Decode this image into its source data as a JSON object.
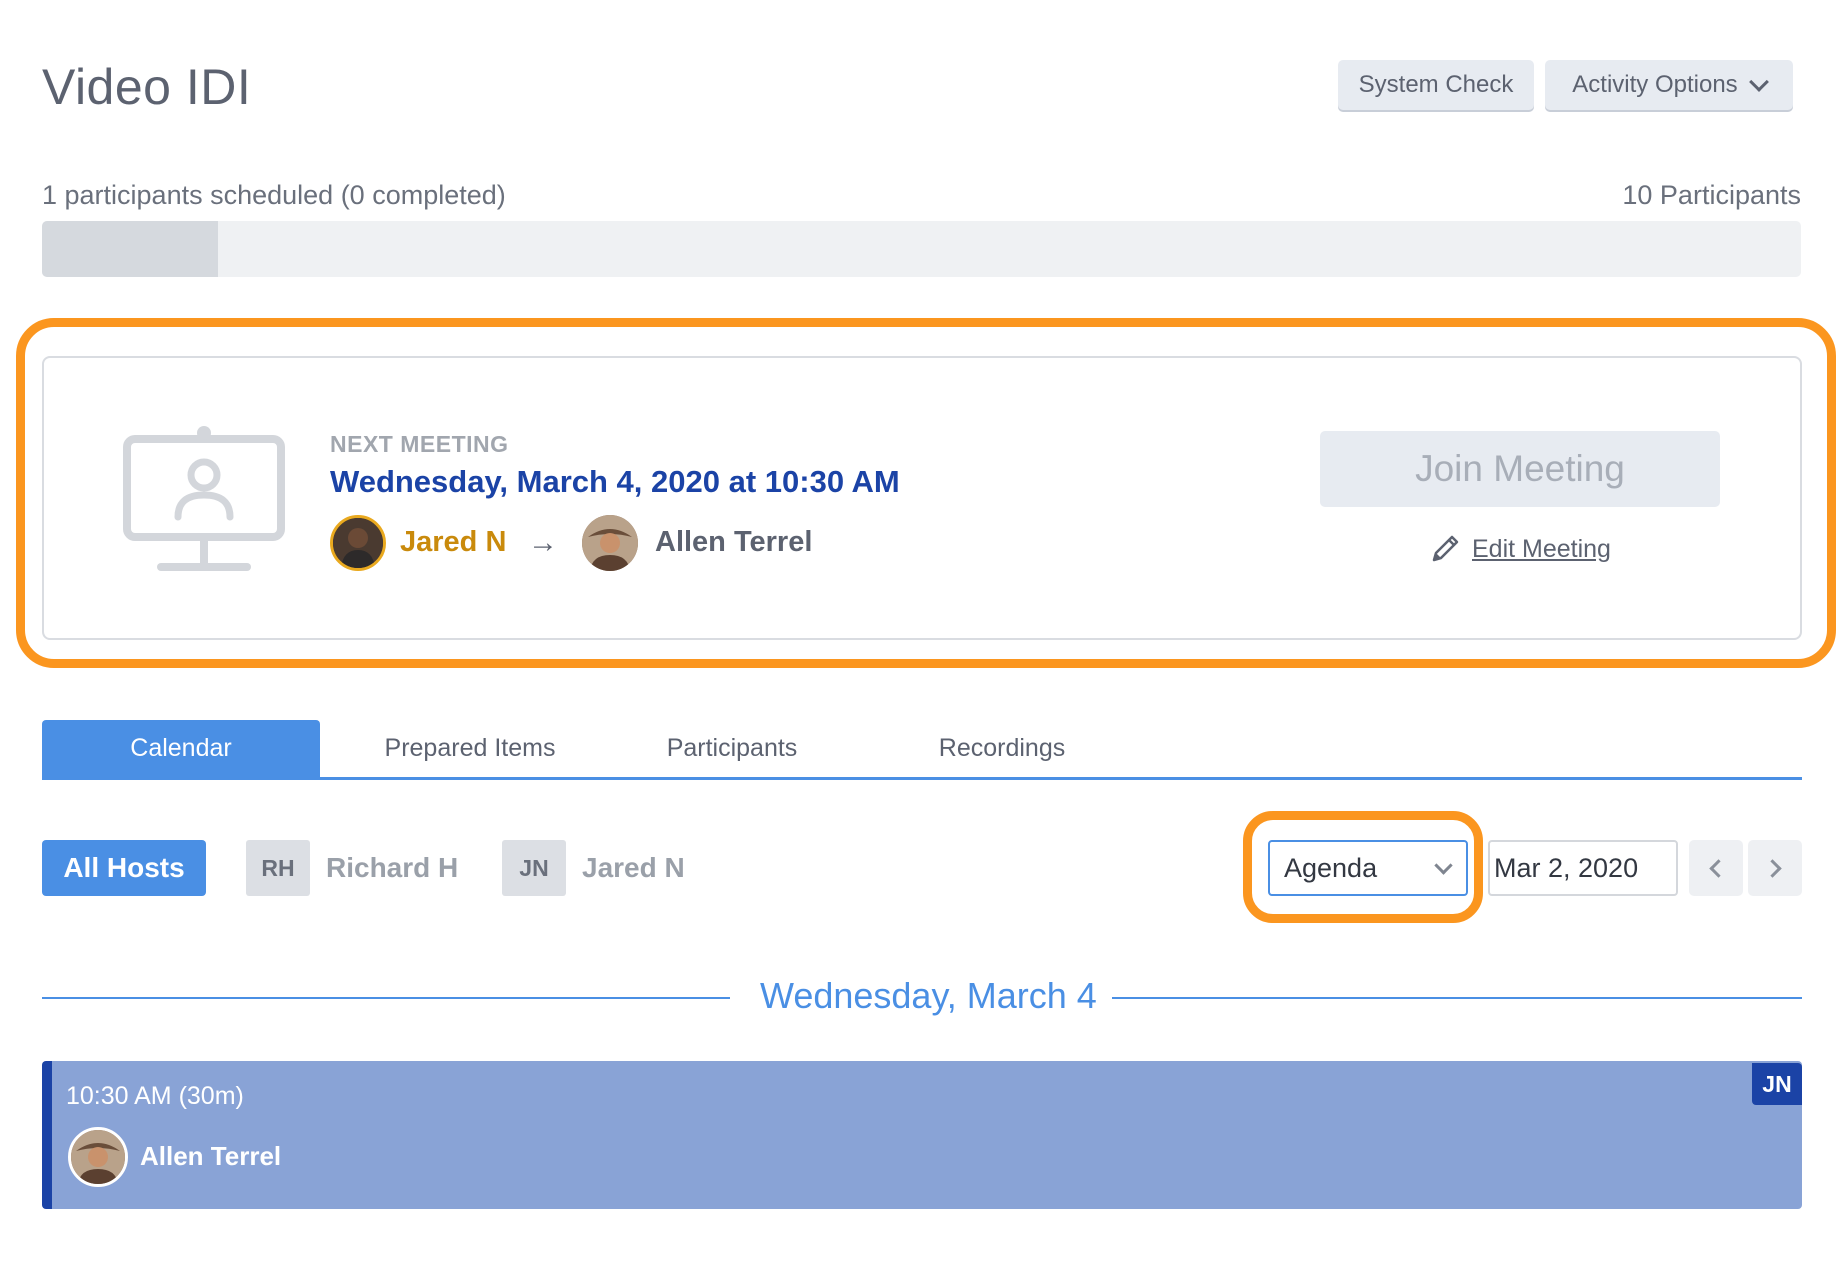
{
  "page": {
    "title": "Video IDI"
  },
  "header": {
    "system_check": "System Check",
    "activity_options": "Activity Options"
  },
  "progress": {
    "scheduled_text": "1 participants scheduled (0 completed)",
    "total_text": "10 Participants",
    "fraction": 0.1
  },
  "next_meeting": {
    "label": "NEXT MEETING",
    "date": "Wednesday, March 4, 2020 at 10:30 AM",
    "host_name": "Jared N",
    "arrow": "→",
    "guest_name": "Allen Terrel",
    "join_label": "Join Meeting",
    "edit_label": "Edit Meeting"
  },
  "tabs": [
    {
      "label": "Calendar",
      "active": true
    },
    {
      "label": "Prepared Items"
    },
    {
      "label": "Participants"
    },
    {
      "label": "Recordings"
    }
  ],
  "hosts_filter": {
    "all_label": "All Hosts",
    "hosts": [
      {
        "initials": "RH",
        "name": "Richard H"
      },
      {
        "initials": "JN",
        "name": "Jared N"
      }
    ]
  },
  "view": {
    "selected": "Agenda",
    "date": "Mar 2, 2020"
  },
  "agenda": {
    "day_label": "Wednesday, March 4",
    "events": [
      {
        "time": "10:30 AM (30m)",
        "name": "Allen Terrel",
        "host_badge": "JN"
      }
    ]
  },
  "colors": {
    "accent": "#4a8fe4",
    "dark_blue": "#1b43a6",
    "highlight": "#fb961f",
    "host_gold": "#c98a0c",
    "event_bg": "#89a3d6"
  },
  "icons": [
    "monitor-user-icon",
    "pencil-icon",
    "chevron-down-icon",
    "chevron-left-icon",
    "chevron-right-icon",
    "arrow-right-icon"
  ]
}
